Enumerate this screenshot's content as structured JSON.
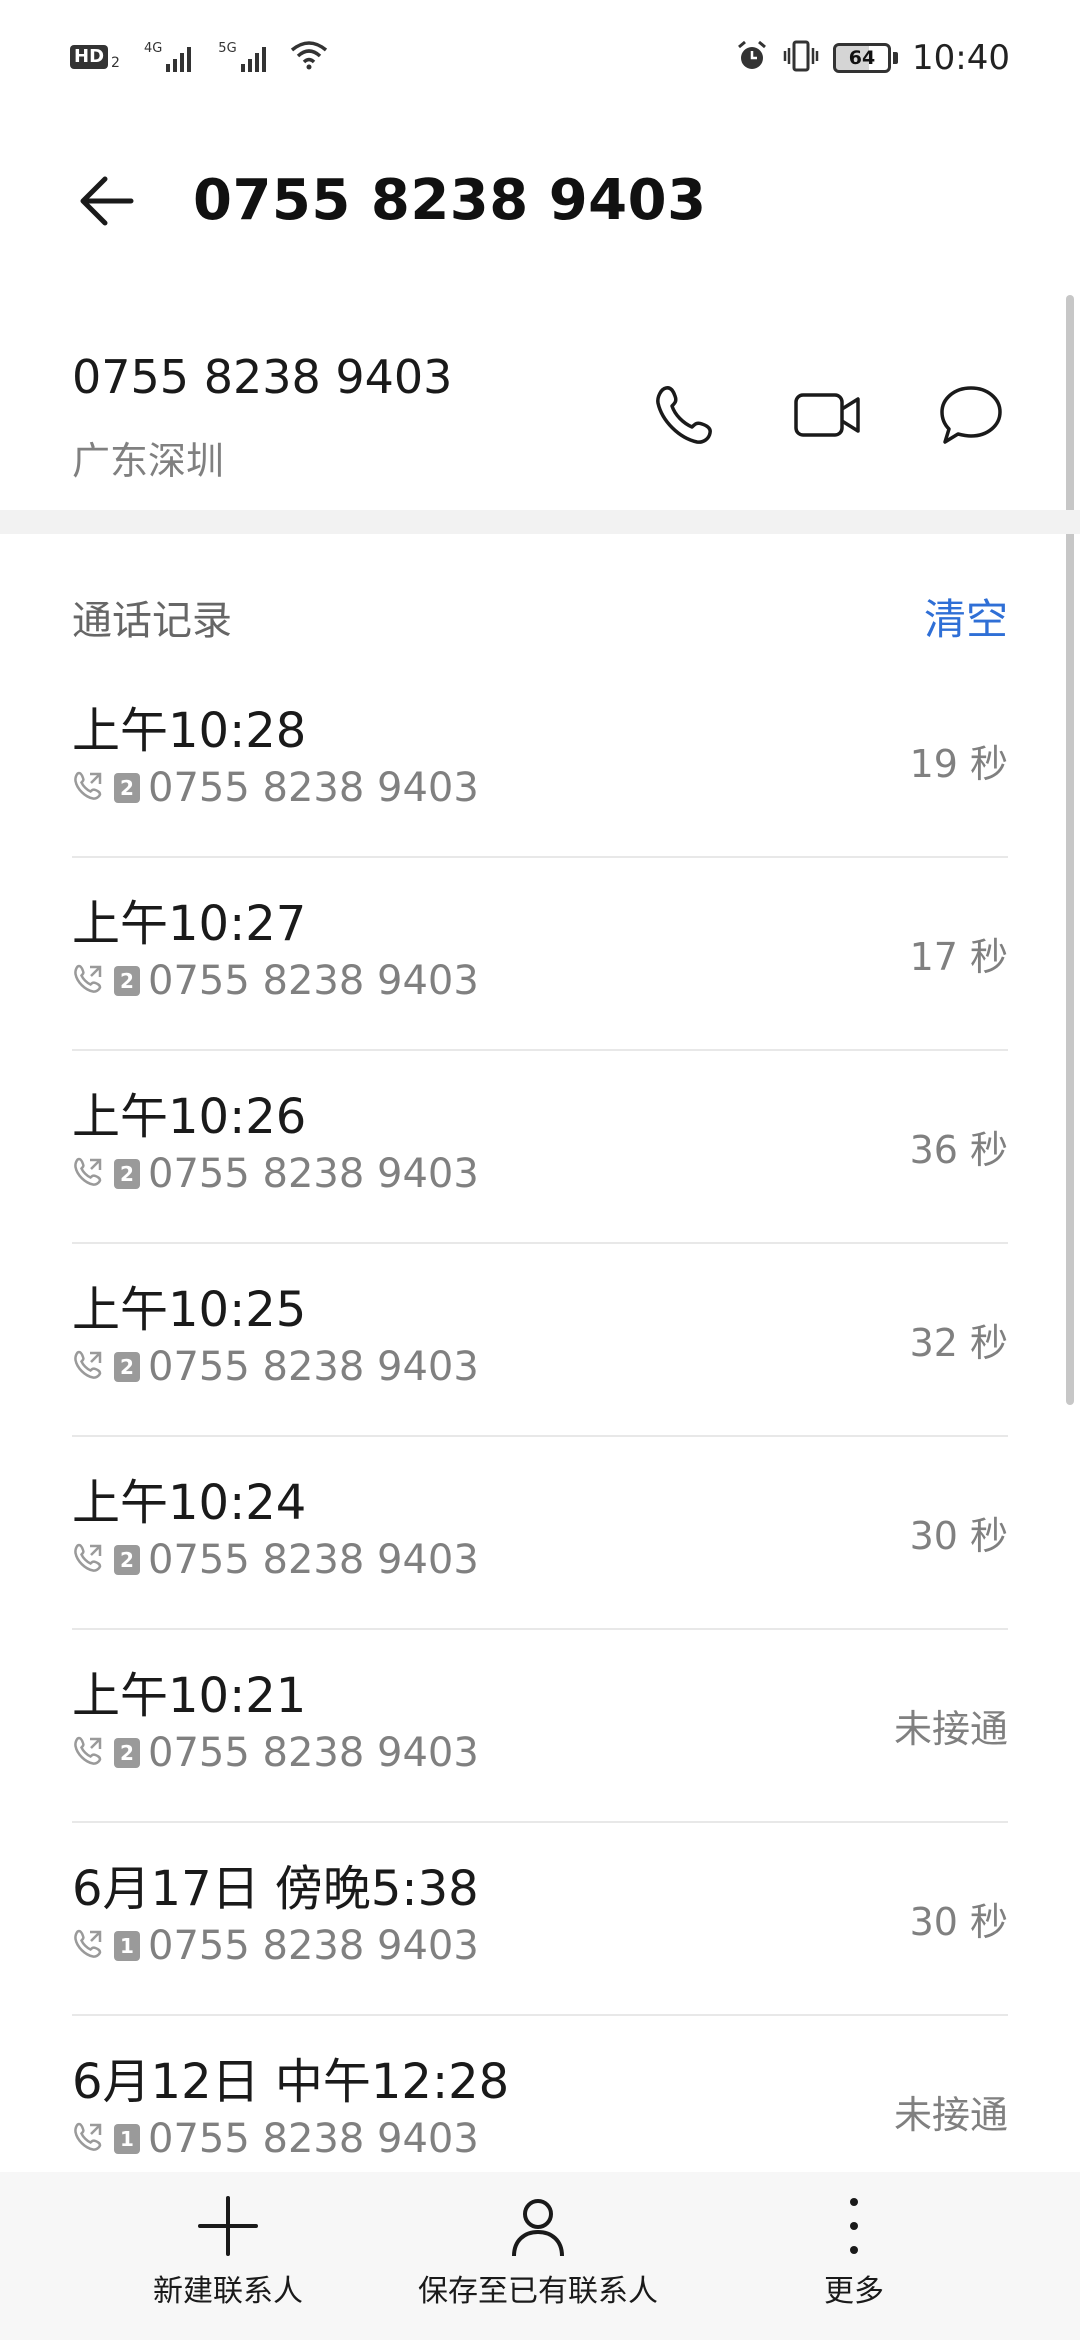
{
  "status_bar": {
    "hd": "HD",
    "hd_sub": "2",
    "net1": "4G",
    "net2": "5G",
    "battery": "64",
    "battery_level": 0.64,
    "time": "10:40",
    "icons": [
      "signal-icon",
      "wifi-icon",
      "alarm-icon",
      "vibrate-icon",
      "battery-icon"
    ]
  },
  "header": {
    "title": "0755 8238 9403",
    "back_icon": "back-arrow-icon"
  },
  "contact": {
    "number": "0755 8238 9403",
    "location": "广东深圳",
    "actions": [
      "phone-icon",
      "video-call-icon",
      "message-icon"
    ]
  },
  "call_log": {
    "title": "通话记录",
    "clear_label": "清空",
    "items": [
      {
        "time": "上午10:28",
        "sim": "2",
        "number": "0755 8238 9403",
        "duration": "19 秒"
      },
      {
        "time": "上午10:27",
        "sim": "2",
        "number": "0755 8238 9403",
        "duration": "17 秒"
      },
      {
        "time": "上午10:26",
        "sim": "2",
        "number": "0755 8238 9403",
        "duration": "36 秒"
      },
      {
        "time": "上午10:25",
        "sim": "2",
        "number": "0755 8238 9403",
        "duration": "32 秒"
      },
      {
        "time": "上午10:24",
        "sim": "2",
        "number": "0755 8238 9403",
        "duration": "30 秒"
      },
      {
        "time": "上午10:21",
        "sim": "2",
        "number": "0755 8238 9403",
        "duration": "未接通"
      },
      {
        "time": "6月17日 傍晚5:38",
        "sim": "1",
        "number": "0755 8238 9403",
        "duration": "30 秒"
      },
      {
        "time": "6月12日 中午12:28",
        "sim": "1",
        "number": "0755 8238 9403",
        "duration": "未接通"
      }
    ]
  },
  "bottom_bar": {
    "new_contact": "新建联系人",
    "save_existing": "保存至已有联系人",
    "more": "更多"
  },
  "colors": {
    "accent": "#2f6fd6",
    "secondary_text": "#808080"
  }
}
